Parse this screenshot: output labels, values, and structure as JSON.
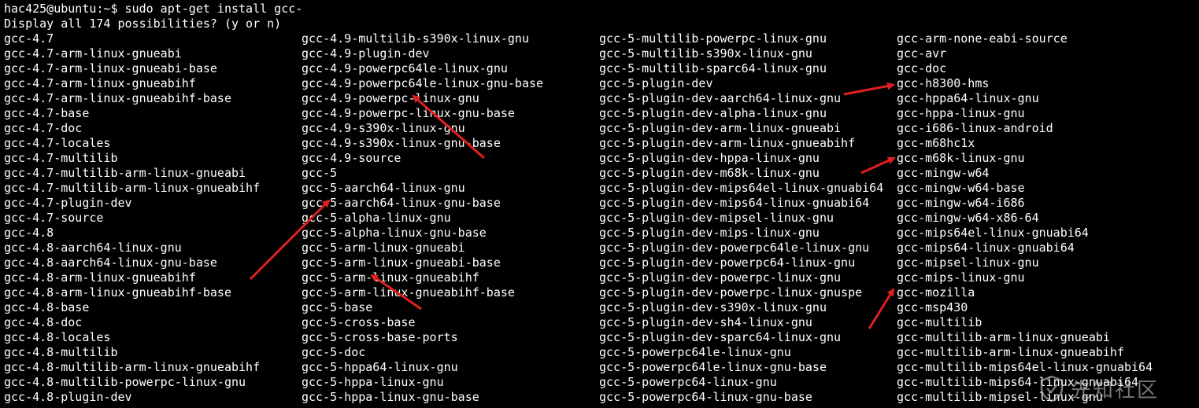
{
  "terminal": {
    "prompt_line": "hac425@ubuntu:~$ sudo apt-get install gcc-",
    "question_line": "Display all 174 possibilities? (y or n)",
    "colors": {
      "background": "#000000",
      "foreground": "#ffffff",
      "arrow": "#e02020"
    },
    "columns": [
      [
        "gcc-4.7",
        "gcc-4.7-arm-linux-gnueabi",
        "gcc-4.7-arm-linux-gnueabi-base",
        "gcc-4.7-arm-linux-gnueabihf",
        "gcc-4.7-arm-linux-gnueabihf-base",
        "gcc-4.7-base",
        "gcc-4.7-doc",
        "gcc-4.7-locales",
        "gcc-4.7-multilib",
        "gcc-4.7-multilib-arm-linux-gnueabi",
        "gcc-4.7-multilib-arm-linux-gnueabihf",
        "gcc-4.7-plugin-dev",
        "gcc-4.7-source",
        "gcc-4.8",
        "gcc-4.8-aarch64-linux-gnu",
        "gcc-4.8-aarch64-linux-gnu-base",
        "gcc-4.8-arm-linux-gnueabihf",
        "gcc-4.8-arm-linux-gnueabihf-base",
        "gcc-4.8-base",
        "gcc-4.8-doc",
        "gcc-4.8-locales",
        "gcc-4.8-multilib",
        "gcc-4.8-multilib-arm-linux-gnueabihf",
        "gcc-4.8-multilib-powerpc-linux-gnu",
        "gcc-4.8-plugin-dev"
      ],
      [
        "gcc-4.9-multilib-s390x-linux-gnu",
        "gcc-4.9-plugin-dev",
        "gcc-4.9-powerpc64le-linux-gnu",
        "gcc-4.9-powerpc64le-linux-gnu-base",
        "gcc-4.9-powerpc-linux-gnu",
        "gcc-4.9-powerpc-linux-gnu-base",
        "gcc-4.9-s390x-linux-gnu",
        "gcc-4.9-s390x-linux-gnu-base",
        "gcc-4.9-source",
        "gcc-5",
        "gcc-5-aarch64-linux-gnu",
        "gcc-5-aarch64-linux-gnu-base",
        "gcc-5-alpha-linux-gnu",
        "gcc-5-alpha-linux-gnu-base",
        "gcc-5-arm-linux-gnueabi",
        "gcc-5-arm-linux-gnueabi-base",
        "gcc-5-arm-linux-gnueabihf",
        "gcc-5-arm-linux-gnueabihf-base",
        "gcc-5-base",
        "gcc-5-cross-base",
        "gcc-5-cross-base-ports",
        "gcc-5-doc",
        "gcc-5-hppa64-linux-gnu",
        "gcc-5-hppa-linux-gnu",
        "gcc-5-hppa-linux-gnu-base"
      ],
      [
        "gcc-5-multilib-powerpc-linux-gnu",
        "gcc-5-multilib-s390x-linux-gnu",
        "gcc-5-multilib-sparc64-linux-gnu",
        "gcc-5-plugin-dev",
        "gcc-5-plugin-dev-aarch64-linux-gnu",
        "gcc-5-plugin-dev-alpha-linux-gnu",
        "gcc-5-plugin-dev-arm-linux-gnueabi",
        "gcc-5-plugin-dev-arm-linux-gnueabihf",
        "gcc-5-plugin-dev-hppa-linux-gnu",
        "gcc-5-plugin-dev-m68k-linux-gnu",
        "gcc-5-plugin-dev-mips64el-linux-gnuabi64",
        "gcc-5-plugin-dev-mips64-linux-gnuabi64",
        "gcc-5-plugin-dev-mipsel-linux-gnu",
        "gcc-5-plugin-dev-mips-linux-gnu",
        "gcc-5-plugin-dev-powerpc64le-linux-gnu",
        "gcc-5-plugin-dev-powerpc64-linux-gnu",
        "gcc-5-plugin-dev-powerpc-linux-gnu",
        "gcc-5-plugin-dev-powerpc-linux-gnuspe",
        "gcc-5-plugin-dev-s390x-linux-gnu",
        "gcc-5-plugin-dev-sh4-linux-gnu",
        "gcc-5-plugin-dev-sparc64-linux-gnu",
        "gcc-5-powerpc64le-linux-gnu",
        "gcc-5-powerpc64le-linux-gnu-base",
        "gcc-5-powerpc64-linux-gnu",
        "gcc-5-powerpc64-linux-gnu-base"
      ],
      [
        "gcc-arm-none-eabi-source",
        "gcc-avr",
        "gcc-doc",
        "gcc-h8300-hms",
        "gcc-hppa64-linux-gnu",
        "gcc-hppa-linux-gnu",
        "gcc-i686-linux-android",
        "gcc-m68hc1x",
        "gcc-m68k-linux-gnu",
        "gcc-mingw-w64",
        "gcc-mingw-w64-base",
        "gcc-mingw-w64-i686",
        "gcc-mingw-w64-x86-64",
        "gcc-mips64el-linux-gnuabi64",
        "gcc-mips64-linux-gnuabi64",
        "gcc-mipsel-linux-gnu",
        "gcc-mips-linux-gnu",
        "gcc-mozilla",
        "gcc-msp430",
        "gcc-multilib",
        "gcc-multilib-arm-linux-gnueabi",
        "gcc-multilib-arm-linux-gnueabihf",
        "gcc-multilib-mips64el-linux-gnuabi64",
        "gcc-multilib-mips64-linux-gnuabi64",
        "gcc-multilib-mipsel-linux-gnu"
      ]
    ]
  },
  "watermark": {
    "text": "先知社区"
  }
}
